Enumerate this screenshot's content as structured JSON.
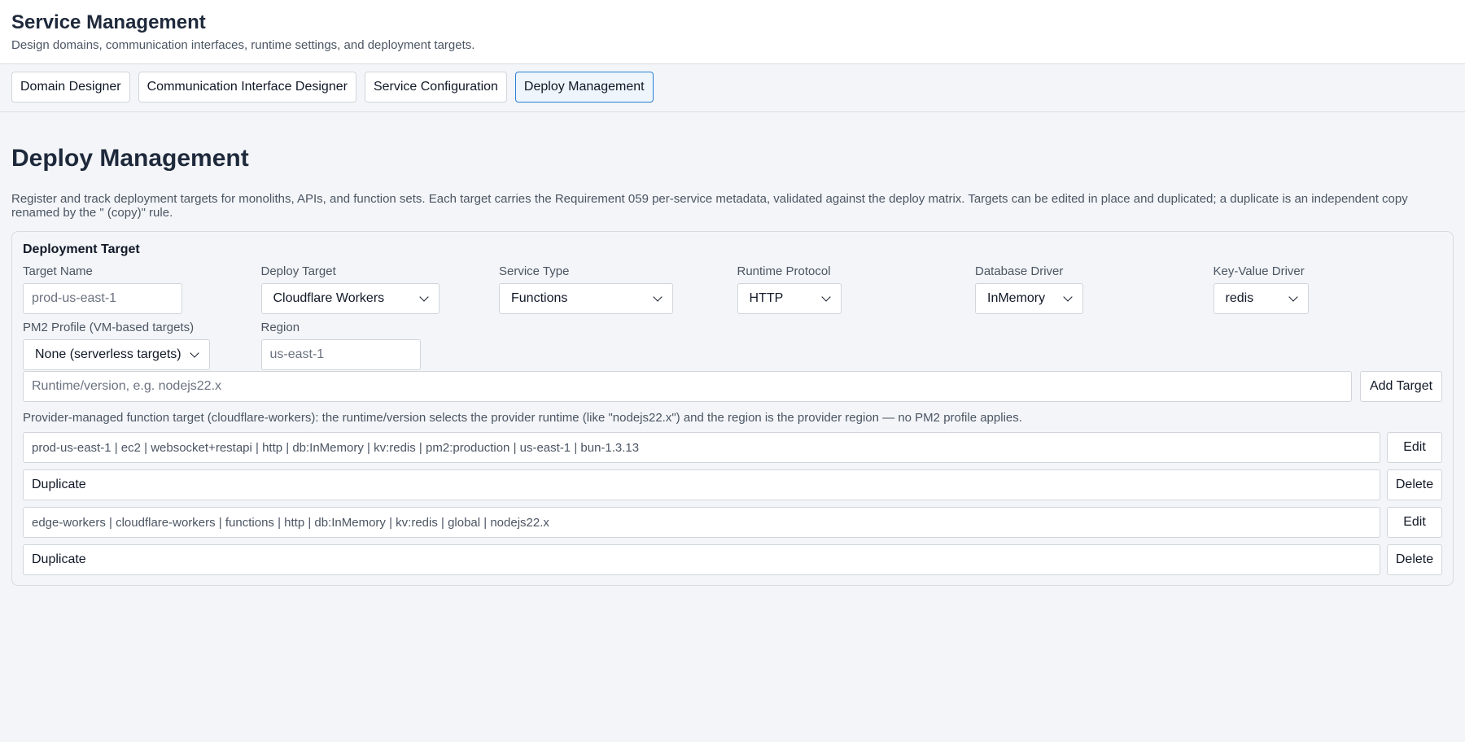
{
  "header": {
    "title": "Service Management",
    "subtitle": "Design domains, communication interfaces, runtime settings, and deployment targets."
  },
  "tabs": [
    {
      "label": "Domain Designer",
      "active": false
    },
    {
      "label": "Communication Interface Designer",
      "active": false
    },
    {
      "label": "Service Configuration",
      "active": false
    },
    {
      "label": "Deploy Management",
      "active": true
    }
  ],
  "main": {
    "title": "Deploy Management",
    "description": "Register and track deployment targets for monoliths, APIs, and function sets. Each target carries the Requirement 059 per-service metadata, validated against the deploy matrix. Targets can be edited in place and duplicated; a duplicate is an independent copy renamed by the \" (copy)\" rule."
  },
  "form": {
    "title": "Deployment Target",
    "target_name": {
      "label": "Target Name",
      "value": "",
      "placeholder": "prod-us-east-1"
    },
    "deploy_target": {
      "label": "Deploy Target",
      "value": "Cloudflare Workers"
    },
    "service_type": {
      "label": "Service Type",
      "value": "Functions"
    },
    "runtime_protocol": {
      "label": "Runtime Protocol",
      "value": "HTTP"
    },
    "database_driver": {
      "label": "Database Driver",
      "value": "InMemory"
    },
    "kv_driver": {
      "label": "Key-Value Driver",
      "value": "redis"
    },
    "pm2_profile": {
      "label": "PM2 Profile (VM-based targets)",
      "value": "None (serverless targets)"
    },
    "region": {
      "label": "Region",
      "value": "",
      "placeholder": "us-east-1"
    },
    "runtime": {
      "value": "",
      "placeholder": "Runtime/version, e.g. nodejs22.x"
    },
    "add_button": "Add Target",
    "hint": "Provider-managed function target (cloudflare-workers): the runtime/version selects the provider runtime (like \"nodejs22.x\") and the region is the provider region — no PM2 profile applies."
  },
  "targets": [
    {
      "summary": "prod-us-east-1 | ec2 | websocket+restapi | http | db:InMemory | kv:redis | pm2:production | us-east-1 | bun-1.3.13",
      "edit_label": "Edit",
      "duplicate_label": "Duplicate",
      "delete_label": "Delete"
    },
    {
      "summary": "edge-workers | cloudflare-workers | functions | http | db:InMemory | kv:redis | global | nodejs22.x",
      "edit_label": "Edit",
      "duplicate_label": "Duplicate",
      "delete_label": "Delete"
    }
  ]
}
